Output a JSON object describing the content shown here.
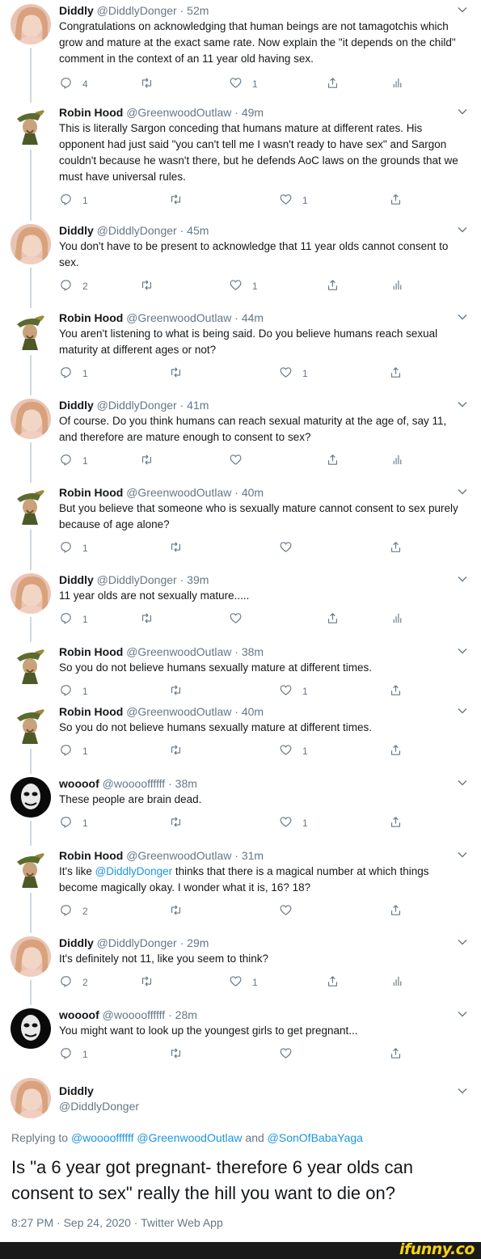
{
  "tweets": [
    {
      "avatar": "diddly",
      "name": "Diddly",
      "handle": "@DiddlyDonger",
      "time": "52m",
      "text": "Congratulations on acknowledging that human beings are not tamagotchis which grow and mature at the exact same rate. Now explain the \"it depends on the child\" comment in the context of an 11 year old having sex.",
      "replies": "4",
      "retweets": "",
      "likes": "1",
      "analytics": true
    },
    {
      "avatar": "robin",
      "name": "Robin Hood",
      "handle": "@GreenwoodOutlaw",
      "time": "49m",
      "text": "This is literally Sargon conceding that humans mature at different rates. His opponent had just said \"you can't tell me I wasn't ready to have sex\" and Sargon couldn't because he wasn't there, but he defends AoC laws on the grounds that we must have universal rules.",
      "replies": "1",
      "retweets": "",
      "likes": "1",
      "analytics": false
    },
    {
      "avatar": "diddly",
      "name": "Diddly",
      "handle": "@DiddlyDonger",
      "time": "45m",
      "text": "You don't have to be present to acknowledge that 11 year olds cannot consent to sex.",
      "replies": "2",
      "retweets": "",
      "likes": "1",
      "analytics": true
    },
    {
      "avatar": "robin",
      "name": "Robin Hood",
      "handle": "@GreenwoodOutlaw",
      "time": "44m",
      "text": "You aren't listening to what is being said. Do you believe humans reach sexual maturity at different ages or not?",
      "replies": "1",
      "retweets": "",
      "likes": "1",
      "analytics": false
    },
    {
      "avatar": "diddly",
      "name": "Diddly",
      "handle": "@DiddlyDonger",
      "time": "41m",
      "text": "Of course. Do you think humans can reach sexual maturity at the age of, say 11, and therefore are mature enough to consent to sex?",
      "replies": "1",
      "retweets": "",
      "likes": "",
      "analytics": true
    },
    {
      "avatar": "robin",
      "name": "Robin Hood",
      "handle": "@GreenwoodOutlaw",
      "time": "40m",
      "text": "But you believe that someone who is sexually mature cannot consent to sex purely because of age alone?",
      "replies": "1",
      "retweets": "",
      "likes": "",
      "analytics": false
    },
    {
      "avatar": "diddly",
      "name": "Diddly",
      "handle": "@DiddlyDonger",
      "time": "39m",
      "text": "11 year olds are not sexually mature.....",
      "replies": "1",
      "retweets": "",
      "likes": "",
      "analytics": true
    },
    {
      "avatar": "robin",
      "name": "Robin Hood",
      "handle": "@GreenwoodOutlaw",
      "time": "38m",
      "text": "So you do not believe humans sexually mature at different times.",
      "replies": "1",
      "retweets": "",
      "likes": "1",
      "analytics": false
    },
    {
      "avatar": "robin",
      "name": "Robin Hood",
      "handle": "@GreenwoodOutlaw",
      "time": "40m",
      "text": "So you do not believe humans sexually mature at different times.",
      "replies": "1",
      "retweets": "",
      "likes": "1",
      "analytics": false
    },
    {
      "avatar": "wooof",
      "name": "woooof",
      "handle": "@wooooffffff",
      "time": "38m",
      "text": "These people are brain dead.",
      "replies": "1",
      "retweets": "",
      "likes": "1",
      "analytics": false
    },
    {
      "avatar": "robin",
      "name": "Robin Hood",
      "handle": "@GreenwoodOutlaw",
      "time": "31m",
      "text_pre": "It's like ",
      "mention": "@DiddlyDonger",
      "text_post": " thinks that there is a magical number at which things become magically okay. I wonder what it is, 16? 18?",
      "text": "",
      "replies": "2",
      "retweets": "",
      "likes": "",
      "analytics": false
    },
    {
      "avatar": "diddly",
      "name": "Diddly",
      "handle": "@DiddlyDonger",
      "time": "29m",
      "text": "It's definitely not 11, like you seem to think?",
      "replies": "2",
      "retweets": "",
      "likes": "1",
      "analytics": true
    },
    {
      "avatar": "wooof",
      "name": "woooof",
      "handle": "@wooooffffff",
      "time": "28m",
      "text": "You might want to look up the youngest girls to get pregnant...",
      "replies": "1",
      "retweets": "",
      "likes": "",
      "analytics": false
    }
  ],
  "main": {
    "name": "Diddly",
    "handle": "@DiddlyDonger",
    "replying_prefix": "Replying to ",
    "replying_mentions": "@wooooffffff @GreenwoodOutlaw",
    "replying_and": " and ",
    "replying_last": "@SonOfBabaYaga",
    "text": "Is \"a 6 year got pregnant- therefore 6 year olds can consent to sex\" really the hill you want to die on?",
    "meta": "8:27 PM · Sep 24, 2020 · Twitter Web App"
  },
  "watermark": "ifunny.co",
  "colors": {
    "accent": "#1b95e0",
    "muted": "#657786",
    "line": "#cfd9de"
  }
}
